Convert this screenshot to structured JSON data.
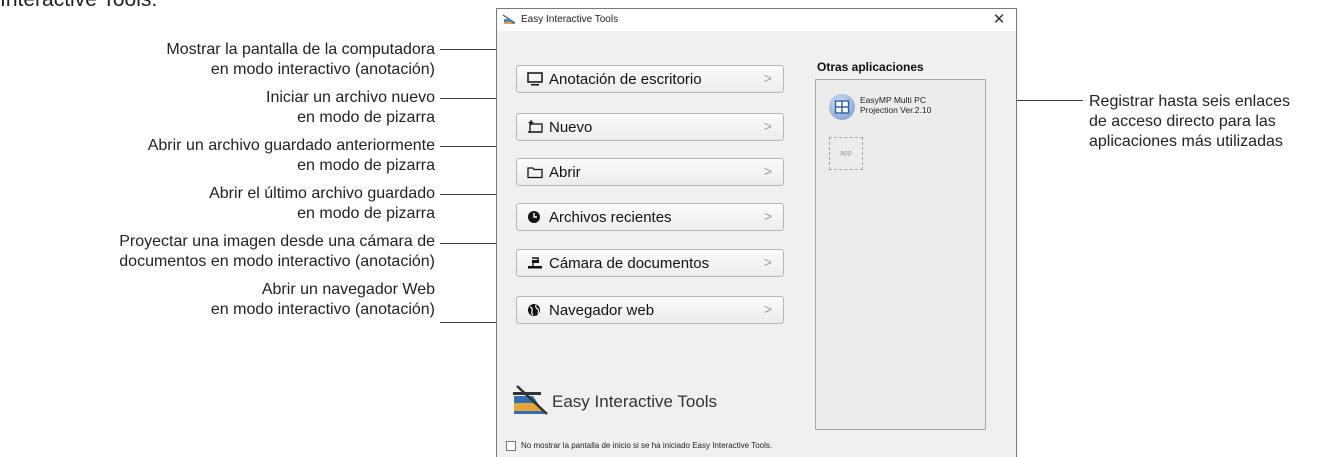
{
  "page": {
    "heading": "Interactive Tools."
  },
  "window": {
    "title": "Easy Interactive Tools",
    "close_glyph": "✕",
    "buttons": [
      {
        "label": "Anotación de escritorio",
        "icon": "monitor-icon"
      },
      {
        "label": "Nuevo",
        "icon": "new-whiteboard-icon"
      },
      {
        "label": "Abrir",
        "icon": "folder-icon"
      },
      {
        "label": "Archivos recientes",
        "icon": "clock-icon"
      },
      {
        "label": "Cámara de documentos",
        "icon": "document-camera-icon"
      },
      {
        "label": "Navegador web",
        "icon": "globe-icon"
      }
    ],
    "chevron": ">",
    "other_apps": {
      "title": "Otras aplicaciones",
      "app_line1": "EasyMP Multi PC",
      "app_line2": "Projection Ver.2.10",
      "empty_slot": "app"
    },
    "brand": "Easy Interactive Tools",
    "startup_checkbox_label": "No mostrar la pantalla de inicio si se ha iniciado Easy Interactive Tools.",
    "startup_checked": false
  },
  "callouts": {
    "left": [
      [
        "Mostrar la pantalla de la computadora",
        "en modo interactivo (anotación)"
      ],
      [
        "Iniciar un archivo nuevo",
        "en modo de pizarra"
      ],
      [
        "Abrir un archivo guardado anteriormente",
        "en modo de pizarra"
      ],
      [
        "Abrir el último archivo guardado",
        "en modo de pizarra"
      ],
      [
        "Proyectar una imagen desde una cámara de",
        "documentos en modo interactivo (anotación)"
      ],
      [
        "Abrir un navegador Web",
        "en modo interactivo (anotación)"
      ]
    ],
    "right": [
      "Registrar hasta seis enlaces",
      "de acceso directo para las",
      "aplicaciones más utilizadas"
    ]
  },
  "colors": {
    "window_bg": "#f0f0f0",
    "panel_bg": "#ececec",
    "brand_blue": "#2f6fb3"
  }
}
